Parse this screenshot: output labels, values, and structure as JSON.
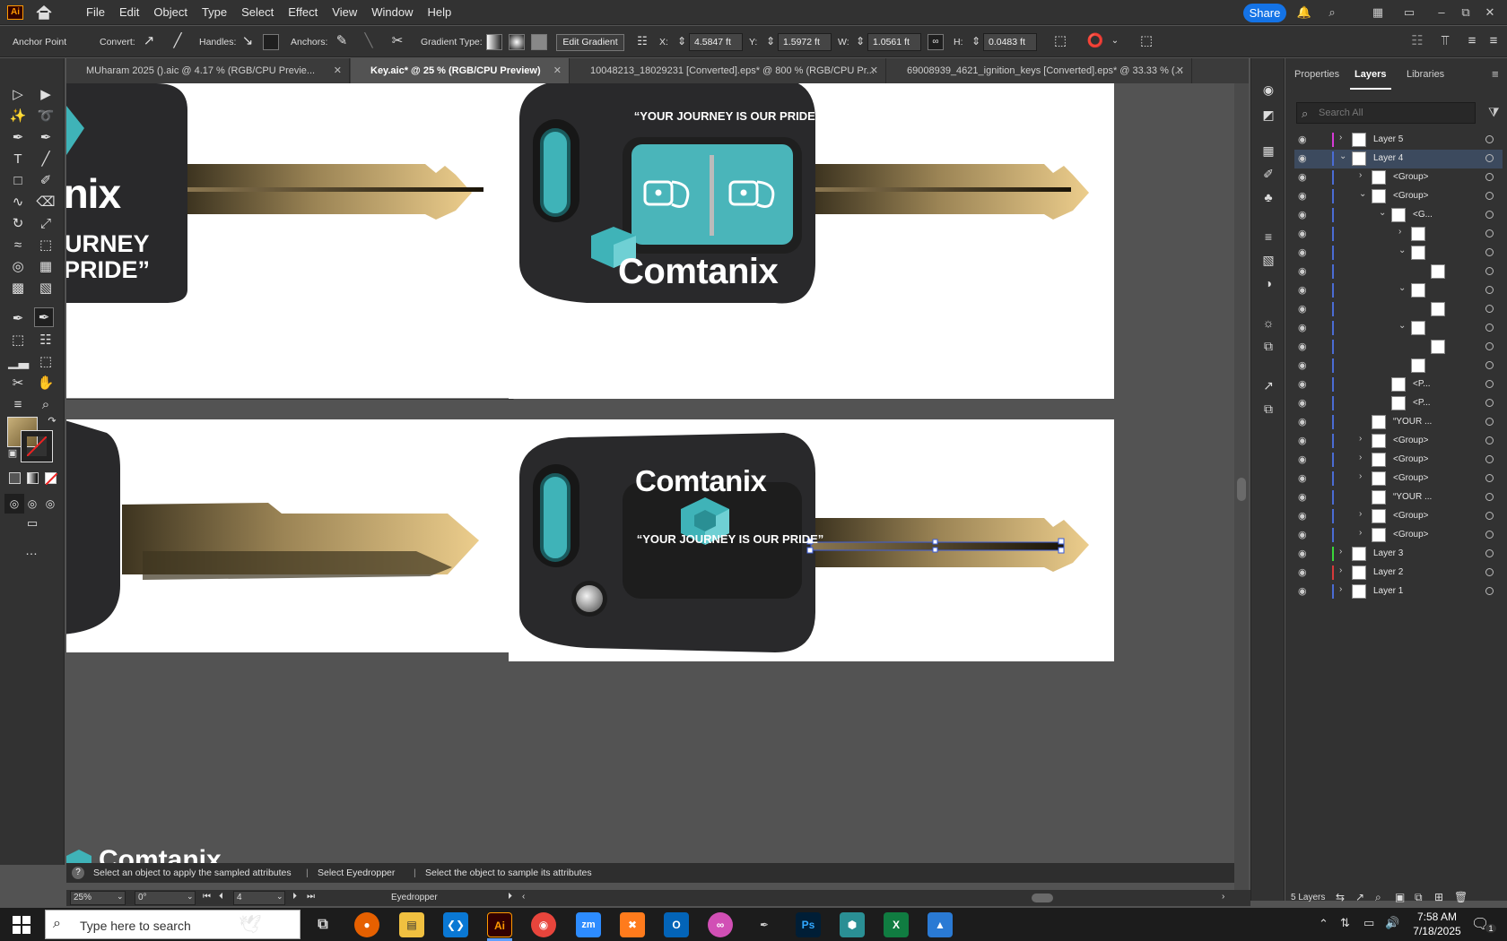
{
  "menubar": {
    "items": [
      "File",
      "Edit",
      "Object",
      "Type",
      "Select",
      "Effect",
      "View",
      "Window",
      "Help"
    ],
    "share_label": "Share",
    "app_icon_label": "Ai"
  },
  "control": {
    "tool_name": "Anchor Point",
    "convert_label": "Convert:",
    "handles_label": "Handles:",
    "anchors_label": "Anchors:",
    "gradient_type_label": "Gradient Type:",
    "edit_gradient_label": "Edit Gradient",
    "x_label": "X:",
    "x_value": "4.5847 ft",
    "y_label": "Y:",
    "y_value": "1.5972 ft",
    "w_label": "W:",
    "w_value": "1.0561 ft",
    "h_label": "H:",
    "h_value": "0.0483 ft"
  },
  "tabs": [
    {
      "label": "MUharam 2025 ().aic @ 4.17 % (RGB/CPU Previe...",
      "active": false
    },
    {
      "label": "Key.aic* @ 25 % (RGB/CPU Preview)",
      "active": true
    },
    {
      "label": "10048213_18029231 [Converted].eps* @ 800 % (RGB/CPU Pr...",
      "active": false
    },
    {
      "label": "69008939_4621_ignition_keys [Converted].eps* @ 33.33 % (...",
      "active": false
    }
  ],
  "artwork": {
    "slogan": "“YOUR JOURNEY IS OUR PRIDE”",
    "brand": "Comtanix",
    "partial_brand": "anix",
    "partial_journey": "URNEY",
    "partial_pride": "PRIDE”",
    "partial_nix": "nix",
    "bottom_brand": "Comtanix"
  },
  "panel": {
    "tabs": [
      "Properties",
      "Layers",
      "Libraries"
    ],
    "active_tab": "Layers",
    "search_placeholder": "Search All",
    "layers": [
      {
        "name": "Layer 5",
        "indent": 0,
        "color": "#d63ad6",
        "expanded": false,
        "selected": false
      },
      {
        "name": "Layer 4",
        "indent": 0,
        "color": "#4a6cd4",
        "expanded": true,
        "selected": true
      },
      {
        "name": "<Group>",
        "indent": 1,
        "color": "#4a6cd4",
        "expanded": false
      },
      {
        "name": "<Group>",
        "indent": 1,
        "color": "#4a6cd4",
        "expanded": true
      },
      {
        "name": "<G...",
        "indent": 2,
        "color": "#4a6cd4",
        "expanded": true
      },
      {
        "name": "",
        "indent": 3,
        "color": "#4a6cd4",
        "expanded": false
      },
      {
        "name": "",
        "indent": 3,
        "color": "#4a6cd4",
        "expanded": true
      },
      {
        "name": "",
        "indent": 4,
        "color": "#4a6cd4"
      },
      {
        "name": "",
        "indent": 3,
        "color": "#4a6cd4",
        "expanded": true
      },
      {
        "name": "",
        "indent": 4,
        "color": "#4a6cd4"
      },
      {
        "name": "",
        "indent": 3,
        "color": "#4a6cd4",
        "expanded": true
      },
      {
        "name": "",
        "indent": 4,
        "color": "#4a6cd4"
      },
      {
        "name": "",
        "indent": 3,
        "color": "#4a6cd4"
      },
      {
        "name": "<P...",
        "indent": 2,
        "color": "#4a6cd4"
      },
      {
        "name": "<P...",
        "indent": 2,
        "color": "#4a6cd4"
      },
      {
        "name": "“YOUR ...",
        "indent": 1,
        "color": "#4a6cd4"
      },
      {
        "name": "<Group>",
        "indent": 1,
        "color": "#4a6cd4",
        "expanded": false
      },
      {
        "name": "<Group>",
        "indent": 1,
        "color": "#4a6cd4",
        "expanded": false
      },
      {
        "name": "<Group>",
        "indent": 1,
        "color": "#4a6cd4",
        "expanded": false
      },
      {
        "name": "“YOUR ...",
        "indent": 1,
        "color": "#4a6cd4"
      },
      {
        "name": "<Group>",
        "indent": 1,
        "color": "#4a6cd4",
        "expanded": false
      },
      {
        "name": "<Group>",
        "indent": 1,
        "color": "#4a6cd4",
        "expanded": false
      },
      {
        "name": "Layer 3",
        "indent": 0,
        "color": "#3ad63a",
        "expanded": false
      },
      {
        "name": "Layer 2",
        "indent": 0,
        "color": "#d63a3a",
        "expanded": false
      },
      {
        "name": "Layer 1",
        "indent": 0,
        "color": "#4a6cd4",
        "expanded": false
      }
    ],
    "footer_count": "5 Layers"
  },
  "hint": {
    "part1": "Select an object to apply the sampled attributes",
    "part2": "Select Eyedropper",
    "part3": "Select the object to sample its attributes"
  },
  "status": {
    "zoom": "25%",
    "rotation": "0°",
    "artboard": "4",
    "tool": "Eyedropper"
  },
  "taskbar": {
    "search_placeholder": "Type here to search",
    "time": "7:58 AM",
    "date": "7/18/2025",
    "notification_count": "1"
  },
  "colors": {
    "key_dark": "#2b2b2d",
    "teal": "#3fb3b8",
    "gold_light": "#e8c987",
    "gold_dark": "#3d3420",
    "accent_blue": "#1473e6"
  }
}
